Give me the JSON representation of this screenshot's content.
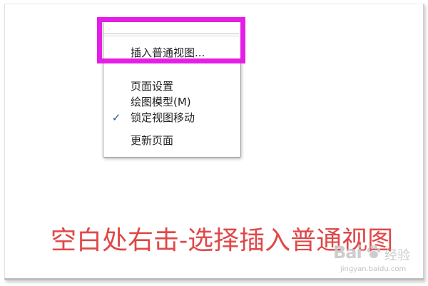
{
  "context_menu": {
    "items": [
      {
        "label": "插入普通视图...",
        "checked": false
      },
      {
        "label": "页面设置",
        "checked": false
      },
      {
        "label": "绘图模型(M)",
        "checked": false
      },
      {
        "label": "锁定视图移动",
        "checked": true
      },
      {
        "label": "更新页面",
        "checked": false
      }
    ],
    "check_glyph": "✓"
  },
  "highlight": {
    "color": "#e51ee5"
  },
  "instruction": {
    "text": "空白处右击-选择插入普通视图",
    "color": "#e04848"
  },
  "watermark": {
    "brand": "Bai",
    "cn": "经验",
    "url": "jingyan.baidu.com",
    "icon": "baidu-paw-icon"
  }
}
